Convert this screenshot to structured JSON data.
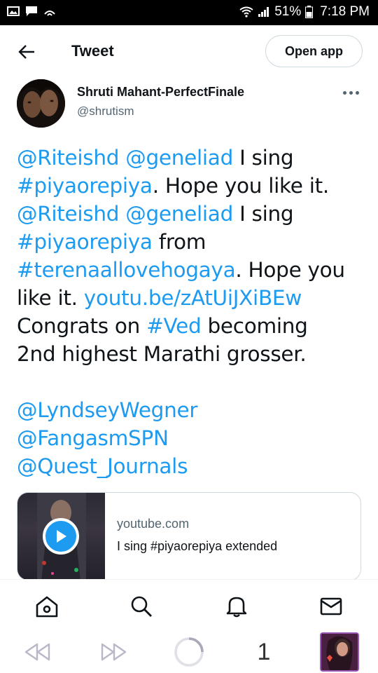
{
  "status_bar": {
    "battery": "51%",
    "time": "7:18 PM",
    "left_icons": [
      "image-icon",
      "message-icon",
      "wifi-call-icon"
    ],
    "right_icons": [
      "wifi-icon",
      "signal-icon",
      "battery-icon"
    ]
  },
  "header": {
    "title": "Tweet",
    "open_app_label": "Open app"
  },
  "author": {
    "name": "Shruti Mahant-PerfectFinale",
    "handle": "@shrutism"
  },
  "tweet": {
    "lines": [
      [
        {
          "t": "@Riteishd",
          "link": true
        },
        {
          "t": " "
        },
        {
          "t": "@geneliad",
          "link": true
        },
        {
          "t": " I sing"
        }
      ],
      [
        {
          "t": "#piyaorepiya",
          "link": true
        },
        {
          "t": ". Hope you like it."
        }
      ],
      [
        {
          "t": "@Riteishd",
          "link": true
        },
        {
          "t": " "
        },
        {
          "t": "@geneliad",
          "link": true
        },
        {
          "t": " I sing"
        }
      ],
      [
        {
          "t": "#piyaorepiya",
          "link": true
        },
        {
          "t": " from"
        }
      ],
      [
        {
          "t": "#terenaallovehogaya",
          "link": true
        },
        {
          "t": ". Hope you"
        }
      ],
      [
        {
          "t": "like it. "
        },
        {
          "t": "youtu.be/zAtUiJXiBEw",
          "link": true
        }
      ],
      [
        {
          "t": "Congrats on "
        },
        {
          "t": "#Ved",
          "link": true
        },
        {
          "t": " becoming"
        }
      ],
      [
        {
          "t": "2nd highest Marathi grosser."
        }
      ],
      [],
      [
        {
          "t": "@LyndseyWegner",
          "link": true
        }
      ],
      [
        {
          "t": "@FangasmSPN",
          "link": true
        }
      ],
      [
        {
          "t": "@Quest_Journals",
          "link": true
        }
      ]
    ]
  },
  "card": {
    "domain": "youtube.com",
    "title": "I sing #piyaorepiya extended"
  },
  "tabbar": {
    "items": [
      "home-icon",
      "search-icon",
      "notifications-icon",
      "messages-icon"
    ]
  },
  "browser_nav": {
    "tabs_count": "1"
  },
  "colors": {
    "link": "#1d9bf0",
    "text": "#0f1419",
    "secondary": "#536471",
    "border": "#cfd9de"
  }
}
